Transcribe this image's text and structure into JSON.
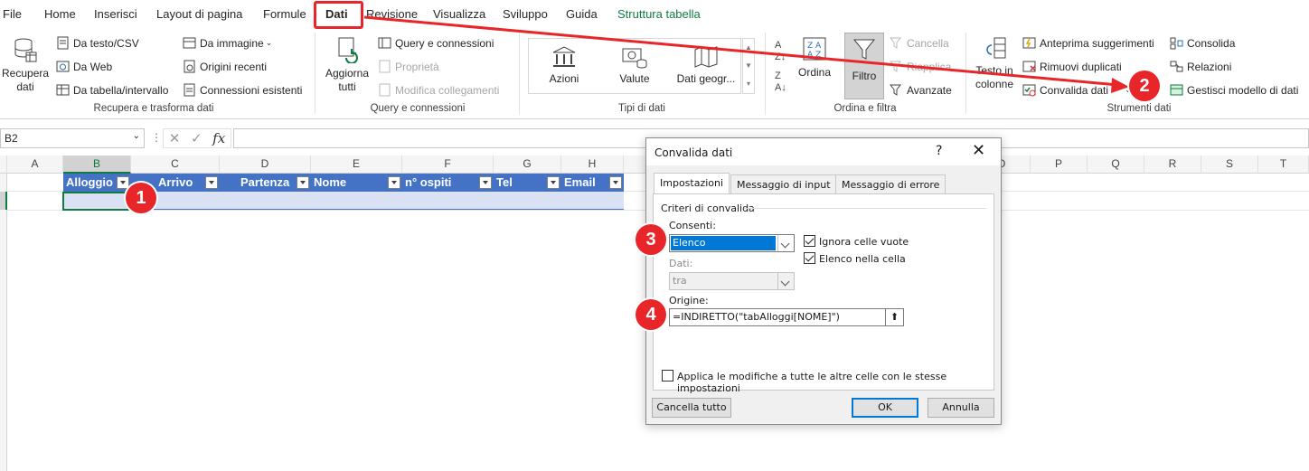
{
  "menu": {
    "tabs": [
      "File",
      "Home",
      "Inserisci",
      "Layout di pagina",
      "Formule",
      "Dati",
      "Revisione",
      "Visualizza",
      "Sviluppo",
      "Guida",
      "Struttura tabella"
    ],
    "active": "Dati"
  },
  "ribbon": {
    "recupera": {
      "big": "Recupera\ndati",
      "items": [
        "Da testo/CSV",
        "Da Web",
        "Da tabella/intervallo",
        "Da immagine",
        "Origini recenti",
        "Connessioni esistenti"
      ],
      "label": "Recupera e trasforma dati"
    },
    "query": {
      "big": "Aggiorna\ntutti",
      "items": [
        "Query e connessioni",
        "Proprietà",
        "Modifica collegamenti"
      ],
      "label": "Query e connessioni"
    },
    "tipi": {
      "items": [
        "Azioni",
        "Valute",
        "Dati geogr..."
      ],
      "label": "Tipi di dati"
    },
    "ordina": {
      "sort_label": "Ordina",
      "filter_label": "Filtro",
      "items": [
        "Cancella",
        "Riapplica",
        "Avanzate"
      ],
      "label": "Ordina e filtra"
    },
    "strumenti": {
      "testo_colonne": "Testo in\ncolonne",
      "items": [
        "Anteprima suggerimenti",
        "Rimuovi duplicati",
        "Convalida dati",
        "Consolida",
        "Relazioni",
        "Gestisci modello di dati"
      ],
      "label": "Strumenti dati"
    }
  },
  "formula_bar": {
    "name_box": "B2",
    "fx": "fx",
    "value": ""
  },
  "grid": {
    "columns": [
      "A",
      "B",
      "C",
      "D",
      "E",
      "F",
      "G",
      "H",
      "P",
      "Q",
      "R",
      "S",
      "T"
    ],
    "hidden_col_letter": "O",
    "table_headers": [
      "Alloggio",
      "Arrivo",
      "Partenza",
      "Nome",
      "n° ospiti",
      "Tel",
      "Email"
    ]
  },
  "dialog": {
    "title": "Convalida dati",
    "help": "?",
    "close": "✕",
    "tabs": [
      "Impostazioni",
      "Messaggio di input",
      "Messaggio di errore"
    ],
    "section": "Criteri di convalida",
    "consenti_label": "Consenti:",
    "consenti_value": "Elenco",
    "ignora_label": "Ignora celle vuote",
    "ignora_checked": true,
    "elenco_label": "Elenco nella cella",
    "elenco_checked": true,
    "dati_label": "Dati:",
    "dati_value": "tra",
    "origine_label": "Origine:",
    "origine_value": "=INDIRETTO(\"tabAlloggi[NOME]\")",
    "applica_label": "Applica le modifiche a tutte le altre celle con le stesse impostazioni",
    "applica_checked": false,
    "btn_clear": "Cancella tutto",
    "btn_ok": "OK",
    "btn_cancel": "Annulla"
  },
  "annotations": [
    "1",
    "2",
    "3",
    "4"
  ],
  "colors": {
    "accent_green": "#107c41",
    "table_header": "#4472c4",
    "table_row": "#d9e1f2",
    "annotation_red": "#e8262a"
  }
}
